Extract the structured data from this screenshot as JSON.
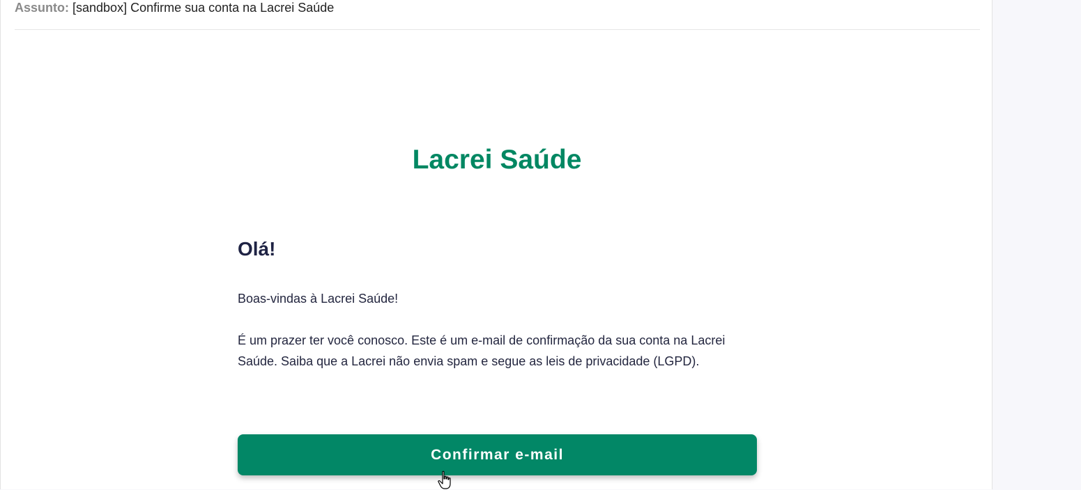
{
  "email": {
    "subject_label": "Assunto:",
    "subject_value": "[sandbox] Confirme sua conta na Lacrei Saúde"
  },
  "brand": {
    "name": "Lacrei Saúde",
    "color": "#018762"
  },
  "body": {
    "greeting": "Olá!",
    "welcome": "Boas-vindas à Lacrei Saúde!",
    "message": "É um prazer ter você conosco. Este é um e-mail de confirmação da sua conta na Lacrei Saúde. Saiba que a Lacrei não envia spam e segue as leis de privacidade (LGPD)."
  },
  "cta": {
    "label": "Confirmar e-mail",
    "color": "#028766"
  },
  "cursor": {
    "icon": "hand-pointer-icon"
  }
}
